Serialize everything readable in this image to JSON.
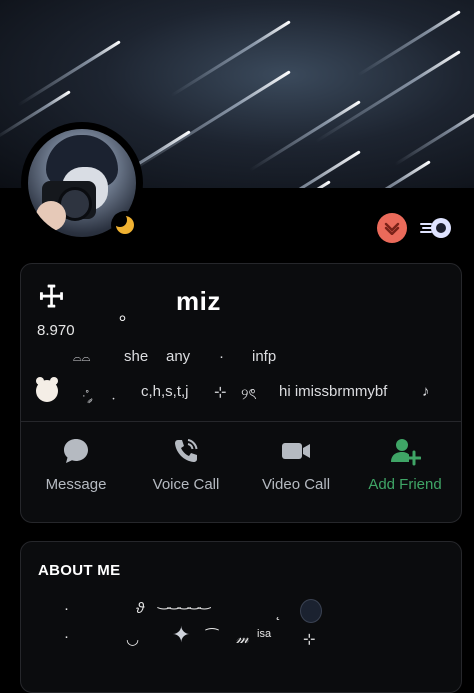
{
  "profile": {
    "name_prefix": "☩",
    "name_sep": "。",
    "display_name": "miz",
    "count": "8.970",
    "status_color": "#f0b232"
  },
  "bio": {
    "line1": [
      "⌓⌓",
      "she",
      "any",
      "·",
      "infp"
    ],
    "line2": [
      "·˚ ༘",
      "﹒",
      "c,h,s,t,j",
      "⊹",
      "୨ৎ",
      "hi imissbrmmybf",
      "♪"
    ]
  },
  "actions": [
    {
      "label": "Message",
      "icon": "message-icon"
    },
    {
      "label": "Voice Call",
      "icon": "voice-call-icon"
    },
    {
      "label": "Video Call",
      "icon": "video-call-icon"
    },
    {
      "label": "Add Friend",
      "icon": "add-friend-icon",
      "color": "#3fa566"
    }
  ],
  "about": {
    "title": "ABOUT ME",
    "line1": [
      "·",
      "ϑ",
      "‿‿‿‿‿",
      "˛"
    ],
    "line2": [
      "·",
      "◡",
      "⁀",
      "𝓂",
      "isa",
      "⊹"
    ]
  },
  "badges": [
    "heart-badge-icon",
    "nitro-badge-icon"
  ]
}
